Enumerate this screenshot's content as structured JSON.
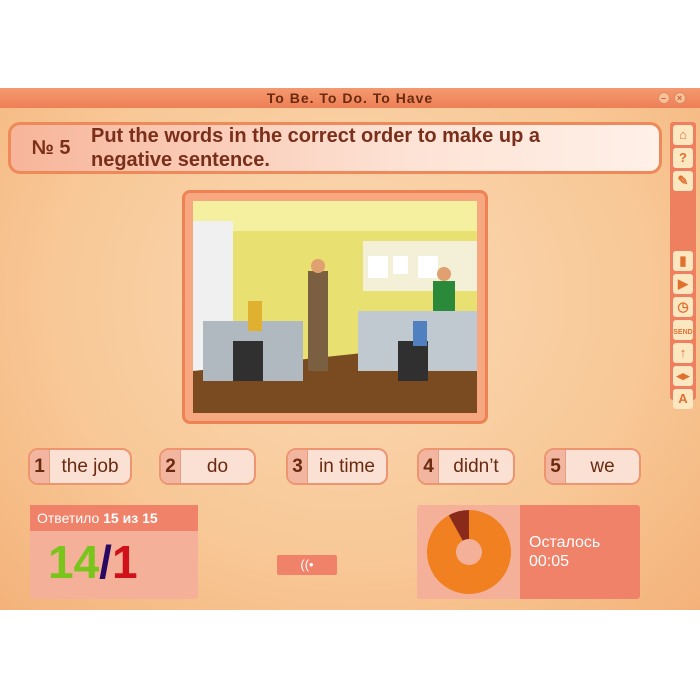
{
  "window": {
    "title": "To Be. To Do. To Have",
    "minimize_icon": "minimize-icon",
    "close_icon": "close-icon"
  },
  "question": {
    "number": "№ 5",
    "text": "Put the words in the correct order to make up a negative sentence."
  },
  "sidebar": {
    "buttons": [
      {
        "name": "home-icon",
        "glyph": "⌂"
      },
      {
        "name": "help-icon",
        "glyph": "?"
      },
      {
        "name": "pencil-icon",
        "glyph": "✎"
      },
      {
        "name": "stats-icon",
        "glyph": "▮"
      },
      {
        "name": "play-next-icon",
        "glyph": "▶"
      },
      {
        "name": "timer-icon",
        "glyph": "◷"
      },
      {
        "name": "send-icon",
        "glyph": "SEND"
      },
      {
        "name": "arrow-up-icon",
        "glyph": "↑"
      },
      {
        "name": "arrows-lr-icon",
        "glyph": "◂▸"
      },
      {
        "name": "font-icon",
        "glyph": "A"
      }
    ]
  },
  "words": [
    {
      "n": "1",
      "w": "the job"
    },
    {
      "n": "2",
      "w": "do"
    },
    {
      "n": "3",
      "w": "in time"
    },
    {
      "n": "4",
      "w": "didn’t"
    },
    {
      "n": "5",
      "w": "we"
    }
  ],
  "score": {
    "label": "Ответило",
    "answered": "15",
    "of": "из",
    "total": "15",
    "correct": "14",
    "sep": "/",
    "wrong": "1",
    "correct_color": "#7ac51c",
    "wrong_color": "#d0101a"
  },
  "wifi": {
    "icon": "wifi-icon"
  },
  "timer": {
    "label": "Осталось",
    "time": "00:05",
    "elapsed_fraction": 0.08,
    "remaining_color": "#f08020",
    "elapsed_color": "#8a2a1a"
  }
}
